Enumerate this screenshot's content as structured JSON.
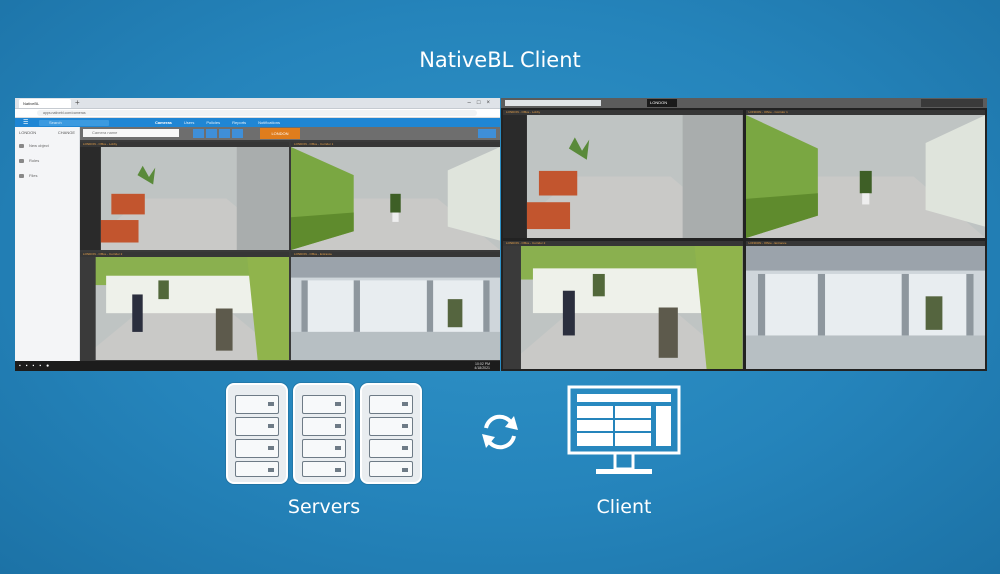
{
  "title": "NativeBL Client",
  "browser": {
    "tab_title": "NativeBL",
    "address": "apps.nativebl.com/cameras",
    "app_nav": [
      "Cameras",
      "Users",
      "Policies",
      "Reports",
      "Notifications"
    ],
    "active_nav": 0,
    "search_placeholder": "Search",
    "sidebar_header": "LONDON",
    "sidebar_header_right": "CHANGE",
    "sidebar_items": [
      "New object",
      "Roles",
      "Files"
    ],
    "camera_search_placeholder": "Camera name",
    "location_tag": "LONDON",
    "taskbar_time": "10:02 PM",
    "taskbar_date": "4/18/2021"
  },
  "native_client": {
    "location_tag": "LONDON"
  },
  "camera_feeds": [
    {
      "label": "LONDON - Office - Lobby",
      "scene": "lobby"
    },
    {
      "label": "LONDON - Office - Corridor 1",
      "scene": "corridor"
    },
    {
      "label": "LONDON - Office - Corridor 2",
      "scene": "hall"
    },
    {
      "label": "LONDON - Office - Entrance",
      "scene": "entrance"
    }
  ],
  "diagram": {
    "servers_label": "Servers",
    "client_label": "Client",
    "sync_icon": "sync-arrows-icon",
    "server_icon": "server-rack-icon",
    "client_icon": "monitor-icon"
  },
  "colors": {
    "background": "#2584bb",
    "app_bar": "#1f86d4",
    "tag": "#e07d1d",
    "camera_header_text": "#e6a04a"
  }
}
